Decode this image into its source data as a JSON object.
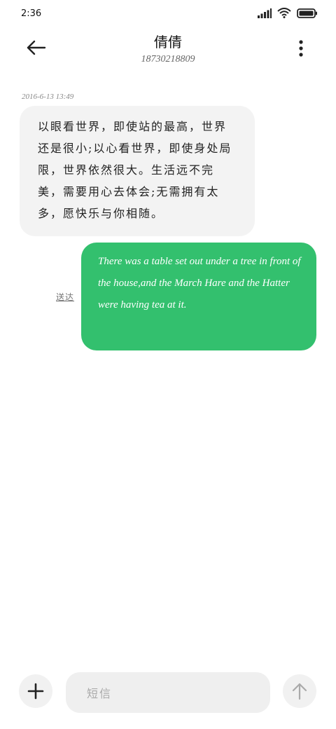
{
  "status_bar": {
    "time": "2:36",
    "icons": [
      "signal-icon",
      "wifi-icon",
      "battery-icon"
    ]
  },
  "header": {
    "contact_name": "倩倩",
    "phone_number": "18730218809"
  },
  "conversation": {
    "timestamp": "2016-6-13 13:49",
    "incoming_message": "以眼看世界，即使站的最高，世界还是很小;以心看世界，即使身处局限，世界依然很大。生活远不完美，需要用心去体会;无需拥有太多，愿快乐与你相随。",
    "outgoing_message": "There was a table set out under a tree in front of the house,and the March Hare and the Hatter were having tea at it.",
    "outgoing_status": "送达"
  },
  "composer": {
    "placeholder": "短信"
  },
  "colors": {
    "outgoing_bubble": "#33c06e",
    "incoming_bubble": "#f3f3f3"
  }
}
